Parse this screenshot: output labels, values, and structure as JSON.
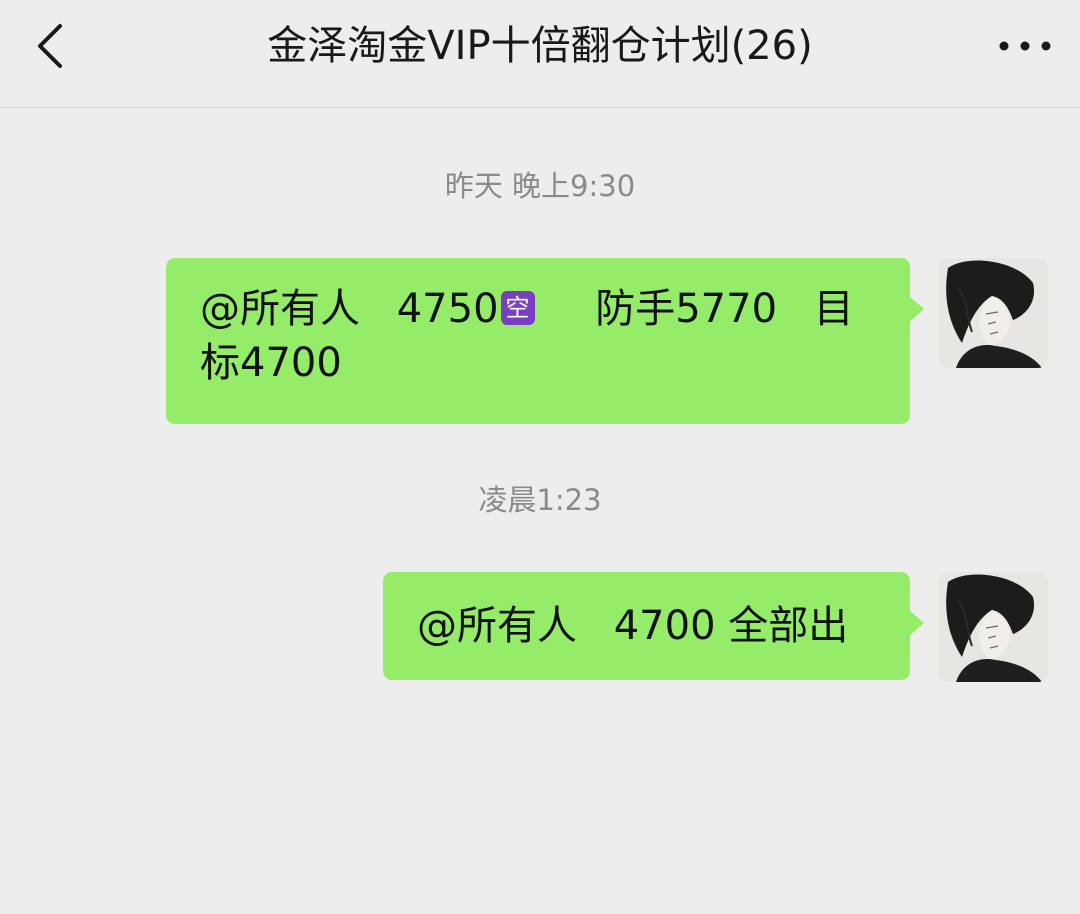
{
  "header": {
    "title": "金泽淘金VIP十倍翻仓计划(26)",
    "back_icon": "chevron-left-icon",
    "more_icon": "more-dots-icon"
  },
  "messages": [
    {
      "time": "昨天 晚上9:30",
      "mention": "@所有人",
      "price": "4750",
      "badge": "空",
      "stop_text": "防手5770",
      "target_line1": "目",
      "target_line2": "标4700"
    },
    {
      "time": "凌晨1:23",
      "mention": "@所有人",
      "text": "4700 全部出"
    }
  ],
  "colors": {
    "background": "#ededed",
    "bubble": "#95ec69",
    "badge": "#7a3fc0",
    "time_text": "#8a8a8a"
  }
}
